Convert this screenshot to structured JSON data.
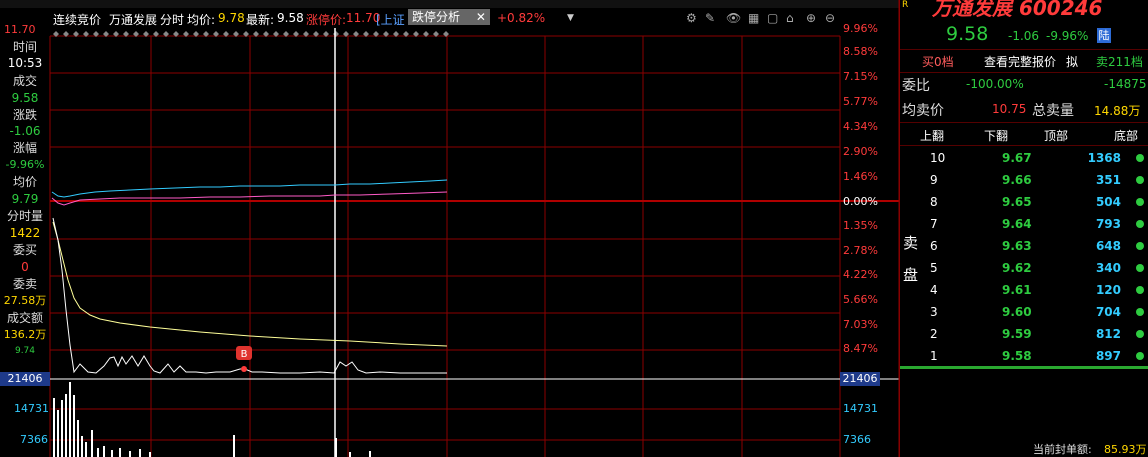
{
  "toolbar": {
    "price_label": "11.70",
    "mode": "连续竞价",
    "stock_name": "万通发展",
    "chart_type": "分时",
    "avg_label": "均价:",
    "avg_value": "9.78",
    "latest_label": "最新:",
    "latest_value": "9.58",
    "limit_label": "涨停价:",
    "limit_value": "11.70",
    "exchange_tag": "[上证",
    "feature_tab": "跌停分析",
    "change": "+0.82%"
  },
  "left_panel": {
    "time_label": "时间",
    "time_value": "10:53",
    "deal_label": "成交",
    "deal_value": "9.58",
    "change_label": "涨跌",
    "change_value": "-1.06",
    "pct_label": "涨幅",
    "pct_value": "-9.96%",
    "avg_label": "均价",
    "avg_value": "9.79",
    "minute_vol_label": "分时量",
    "minute_vol_value": "1422",
    "bid_label": "委买",
    "bid_value": "0",
    "ask_label": "委卖",
    "ask_value": "27.58万",
    "amount_label": "成交额",
    "amount_value": "136.2万",
    "low_label": "9.74"
  },
  "right_axis": [
    "9.96%",
    "8.58%",
    "7.15%",
    "5.77%",
    "4.34%",
    "2.90%",
    "1.46%",
    "0.00%",
    "1.35%",
    "2.78%",
    "4.22%",
    "5.66%",
    "7.03%",
    "8.47%"
  ],
  "volume_axis": {
    "left": [
      "21406",
      "14731",
      "7366"
    ],
    "right": [
      "21406",
      "14731",
      "7366"
    ]
  },
  "marker_label": "B",
  "stock_panel": {
    "title": "万通发展 600246",
    "price": "9.58",
    "change": "-1.06",
    "pct": "-9.96%",
    "status_badge": "陆",
    "btn_buy0": "买0档",
    "btn_full_quote": "查看完整报价",
    "btn_simulate": "拟",
    "btn_sell": "卖211档",
    "weibi_label": "委比",
    "weibi_value": "-100.00%",
    "weibi_diff": "-14875",
    "avg_sell_label": "均卖价",
    "avg_sell_value": "10.75",
    "total_sell_label": "总卖量",
    "total_sell_value": "14.88万",
    "nav_up": "上翻",
    "nav_down": "下翻",
    "nav_top": "顶部",
    "nav_bottom": "底部",
    "side_label_1": "卖",
    "side_label_2": "盘",
    "sell_orders": [
      {
        "level": "10",
        "price": "9.67",
        "qty": "1368"
      },
      {
        "level": "9",
        "price": "9.66",
        "qty": "351"
      },
      {
        "level": "8",
        "price": "9.65",
        "qty": "504"
      },
      {
        "level": "7",
        "price": "9.64",
        "qty": "793"
      },
      {
        "level": "6",
        "price": "9.63",
        "qty": "648"
      },
      {
        "level": "5",
        "price": "9.62",
        "qty": "340"
      },
      {
        "level": "4",
        "price": "9.61",
        "qty": "120"
      },
      {
        "level": "3",
        "price": "9.60",
        "qty": "704"
      },
      {
        "level": "2",
        "price": "9.59",
        "qty": "812"
      },
      {
        "level": "1",
        "price": "9.58",
        "qty": "897"
      }
    ],
    "footer_label": "当前封单额:",
    "footer_value": "85.93万"
  },
  "colors": {
    "red": "#ff3b3b",
    "green": "#2ecc40",
    "yellow": "#ffd700",
    "cyan": "#33ccff",
    "grid": "#8b0000"
  }
}
